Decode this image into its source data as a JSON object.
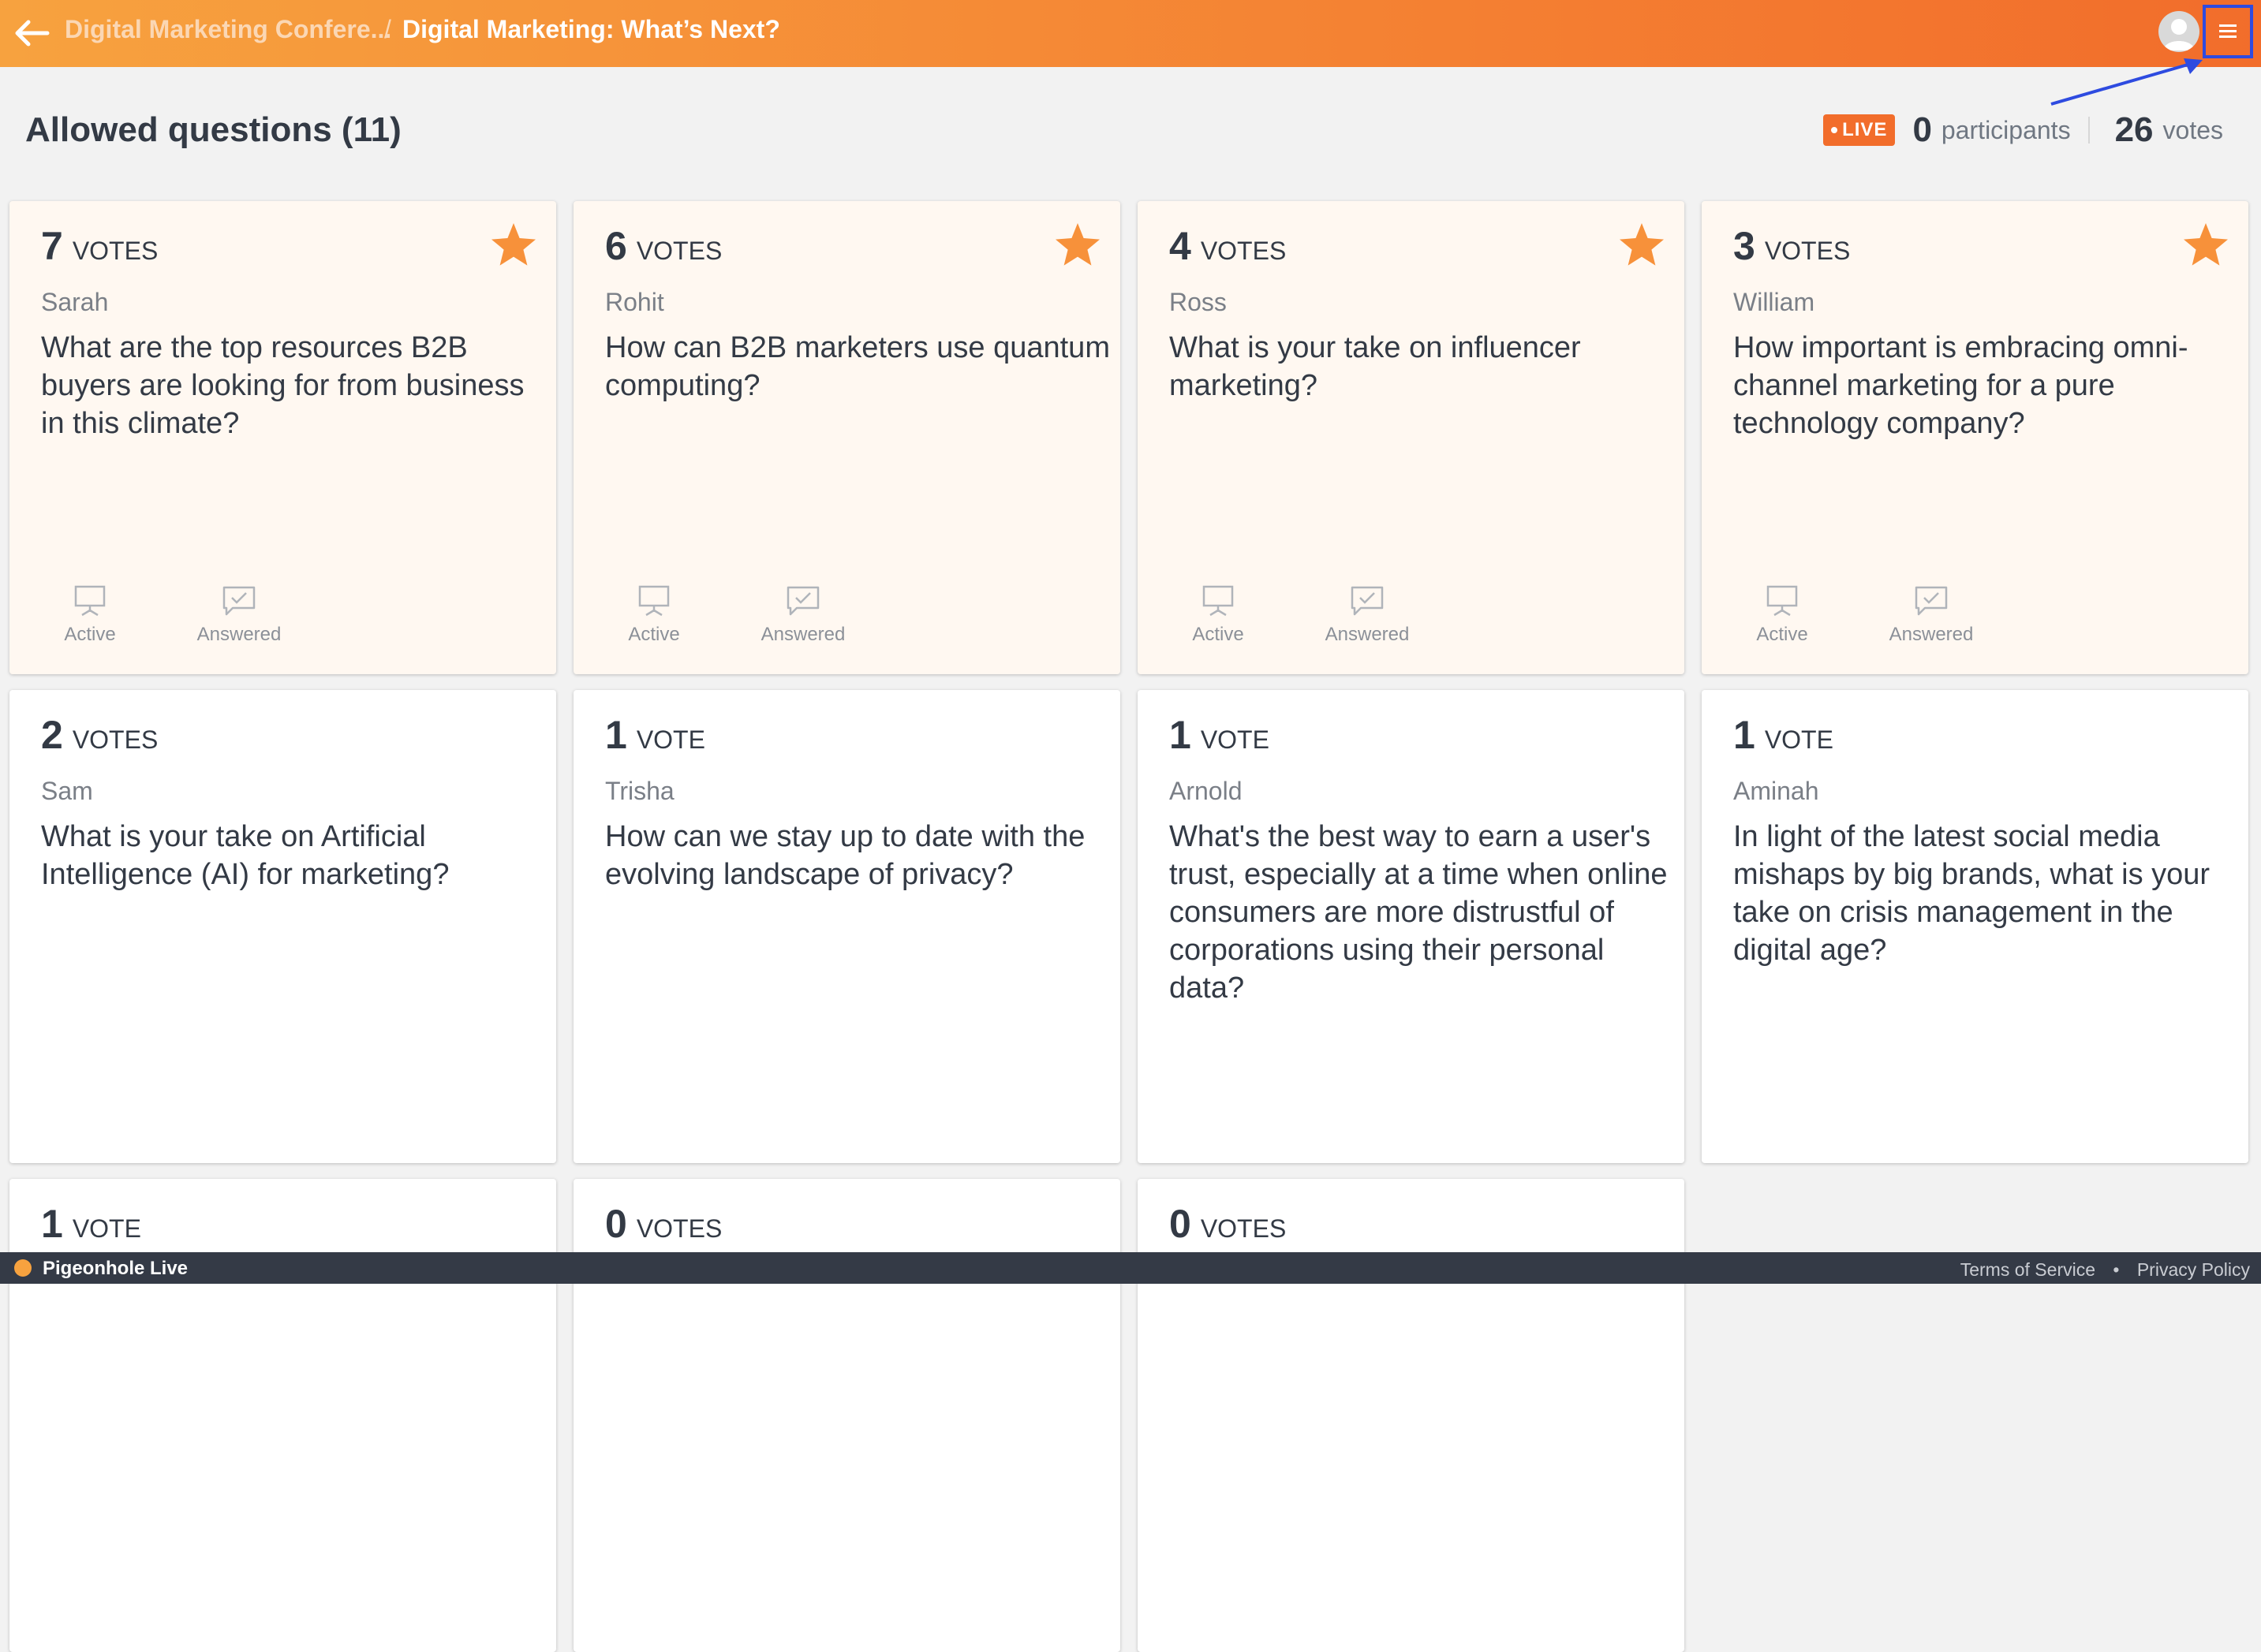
{
  "header": {
    "breadcrumb_parent": "Digital Marketing Confere...",
    "breadcrumb_separator": "/",
    "breadcrumb_current": "Digital Marketing: What’s Next?"
  },
  "title": "Allowed questions (11)",
  "stats": {
    "live_label": "LIVE",
    "participants_count": "0",
    "participants_label": "participants",
    "votes_count": "26",
    "votes_label": "votes"
  },
  "action_labels": {
    "active": "Active",
    "answered": "Answered"
  },
  "questions": [
    {
      "votes": "7",
      "vote_word": "votes",
      "author": "Sarah",
      "text": "What are the top resources B2B buyers are looking for from business in this climate?",
      "starred": true
    },
    {
      "votes": "6",
      "vote_word": "votes",
      "author": "Rohit",
      "text": "How can B2B marketers use quantum computing?",
      "starred": true
    },
    {
      "votes": "4",
      "vote_word": "votes",
      "author": "Ross",
      "text": "What is your take on influencer marketing?",
      "starred": true
    },
    {
      "votes": "3",
      "vote_word": "votes",
      "author": "William",
      "text": "How important is embracing omni-channel marketing for a pure technology company?",
      "starred": true
    },
    {
      "votes": "2",
      "vote_word": "votes",
      "author": "Sam",
      "text": "What is your take on Artificial Intelligence (AI) for marketing?",
      "starred": false
    },
    {
      "votes": "1",
      "vote_word": "vote",
      "author": "Trisha",
      "text": "How can we stay up to date with the evolving landscape of privacy?",
      "starred": false
    },
    {
      "votes": "1",
      "vote_word": "vote",
      "author": "Arnold",
      "text": "What's the best way to earn a user's trust, especially at a time when online consumers are more distrustful of corporations using their personal data?",
      "starred": false
    },
    {
      "votes": "1",
      "vote_word": "vote",
      "author": "Aminah",
      "text": "In light of the latest social media mishaps by big brands, what is your take on crisis management in the digital age?",
      "starred": false
    },
    {
      "votes": "1",
      "vote_word": "vote",
      "author": "",
      "text": "",
      "starred": false
    },
    {
      "votes": "0",
      "vote_word": "votes",
      "author": "",
      "text": "",
      "starred": false
    },
    {
      "votes": "0",
      "vote_word": "votes",
      "author": "",
      "text": "",
      "starred": false
    }
  ],
  "footer": {
    "brand": "Pigeonhole Live",
    "terms": "Terms of Service",
    "separator": "•",
    "privacy": "Privacy Policy"
  },
  "colors": {
    "header_start": "#f7a23f",
    "header_end": "#f26d2b",
    "star": "#f7913a",
    "live_badge": "#f26d2b",
    "annotation": "#2e4be0",
    "footer": "#343a46"
  },
  "icons": {
    "back": "arrow-left-icon",
    "menu": "hamburger-menu-icon",
    "star": "star-icon",
    "active": "presentation-screen-icon",
    "answered": "checked-message-icon",
    "avatar": "user-avatar-icon"
  }
}
